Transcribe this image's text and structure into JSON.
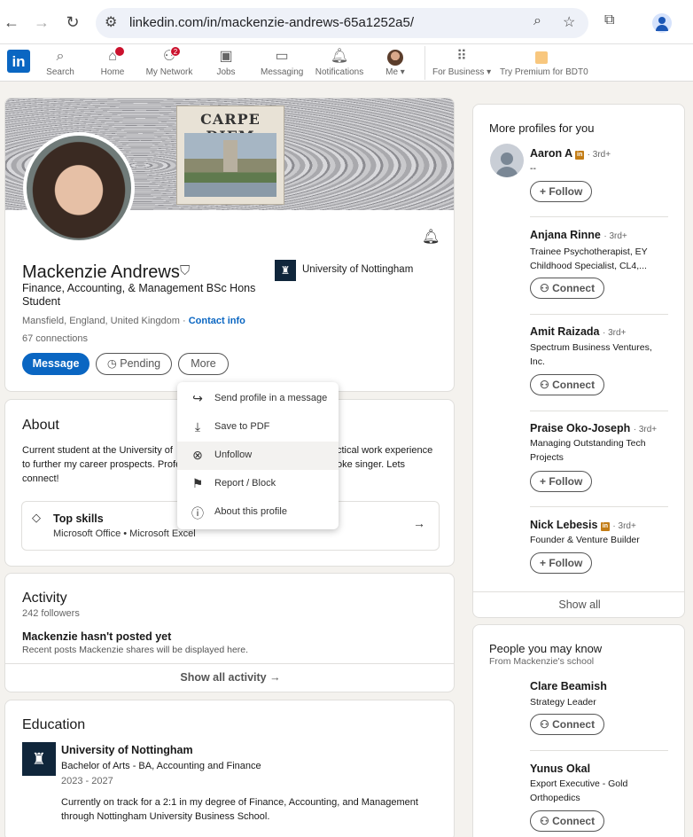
{
  "browser": {
    "url": "linkedin.com/in/mackenzie-andrews-65a1252a5/"
  },
  "nav": {
    "logo": "in",
    "items": [
      {
        "label": "Search",
        "icon": "search-icon"
      },
      {
        "label": "Home",
        "icon": "home-icon",
        "badge": ""
      },
      {
        "label": "My Network",
        "icon": "network-icon",
        "badge": "2"
      },
      {
        "label": "Jobs",
        "icon": "briefcase-icon"
      },
      {
        "label": "Messaging",
        "icon": "messaging-icon"
      },
      {
        "label": "Notifications",
        "icon": "bell-icon"
      },
      {
        "label": "Me ▾",
        "icon": "avatar"
      }
    ],
    "business_label": "For Business ▾",
    "premium_label": "Try Premium for BDT0"
  },
  "profile": {
    "banner_title": "CARPE DIEM",
    "name": "Mackenzie Andrews",
    "university": "University of Nottingham",
    "headline": "Finance, Accounting, & Management BSc Hons Student",
    "location": "Mansfield, England, United Kingdom · ",
    "contact_info": "Contact info",
    "connections": "67 connections",
    "message_label": "Message",
    "pending_label": "Pending",
    "more_label": "More"
  },
  "dropdown": {
    "items": [
      {
        "label": "Send profile in a message",
        "icon": "share-icon"
      },
      {
        "label": "Save to PDF",
        "icon": "download-icon"
      },
      {
        "label": "Unfollow",
        "icon": "close-circle-icon"
      },
      {
        "label": "Report / Block",
        "icon": "flag-icon"
      },
      {
        "label": "About this profile",
        "icon": "info-icon"
      }
    ]
  },
  "about": {
    "title": "About",
    "text_line1_left": "Current student at the University of",
    "text_line1_right": "ctical work experience",
    "text_line2_left": "to further my career prospects. Profe",
    "text_line2_right": "oke singer. Lets",
    "text_line3": "connect!",
    "skills_title": "Top skills",
    "skills_list": "Microsoft Office • Microsoft Excel"
  },
  "activity": {
    "title": "Activity",
    "followers": "242 followers",
    "empty_title": "Mackenzie hasn't posted yet",
    "empty_sub": "Recent posts Mackenzie shares will be displayed here.",
    "show_all": "Show all activity →"
  },
  "education": {
    "title": "Education",
    "school": "University of Nottingham",
    "degree": "Bachelor of Arts - BA, Accounting and Finance",
    "years": "2023 - 2027",
    "desc_line1": "Currently on track for a 2:1 in my degree of Finance, Accounting, and Management",
    "desc_line2": "through Nottingham University Business School."
  },
  "more_profiles": {
    "title": "More profiles for you",
    "people": [
      {
        "name": "Aaron A",
        "degree": "· 3rd+",
        "linkedin_badge": true,
        "headline": "--",
        "action": "+ Follow"
      },
      {
        "name": "Anjana Rinne",
        "degree": "· 3rd+",
        "linkedin_badge": false,
        "headline": "Trainee Psychotherapist, EY Childhood Specialist, CL4,...",
        "action": "Connect"
      },
      {
        "name": "Amit Raizada",
        "degree": "· 3rd+",
        "linkedin_badge": false,
        "headline": "Spectrum Business Ventures, Inc.",
        "action": "Connect"
      },
      {
        "name": "Praise Oko-Joseph",
        "degree": "· 3rd+",
        "linkedin_badge": false,
        "headline": "Managing Outstanding Tech Projects",
        "action": "+ Follow"
      },
      {
        "name": "Nick Lebesis",
        "degree": "· 3rd+",
        "linkedin_badge": true,
        "headline": "Founder & Venture Builder",
        "action": "+ Follow"
      }
    ],
    "show_all": "Show all"
  },
  "people_you_may_know": {
    "title": "People you may know",
    "subtitle": "From Mackenzie's school",
    "people": [
      {
        "name": "Clare Beamish",
        "headline": "Strategy Leader",
        "action": "Connect"
      },
      {
        "name": "Yunus Okal",
        "headline": "Export Executive - Gold Orthopedics",
        "action": "Connect"
      }
    ]
  },
  "colors": {
    "brand_blue": "#0a66c2",
    "badge_red": "#cb112d",
    "page_bg": "#f4f2ee"
  }
}
